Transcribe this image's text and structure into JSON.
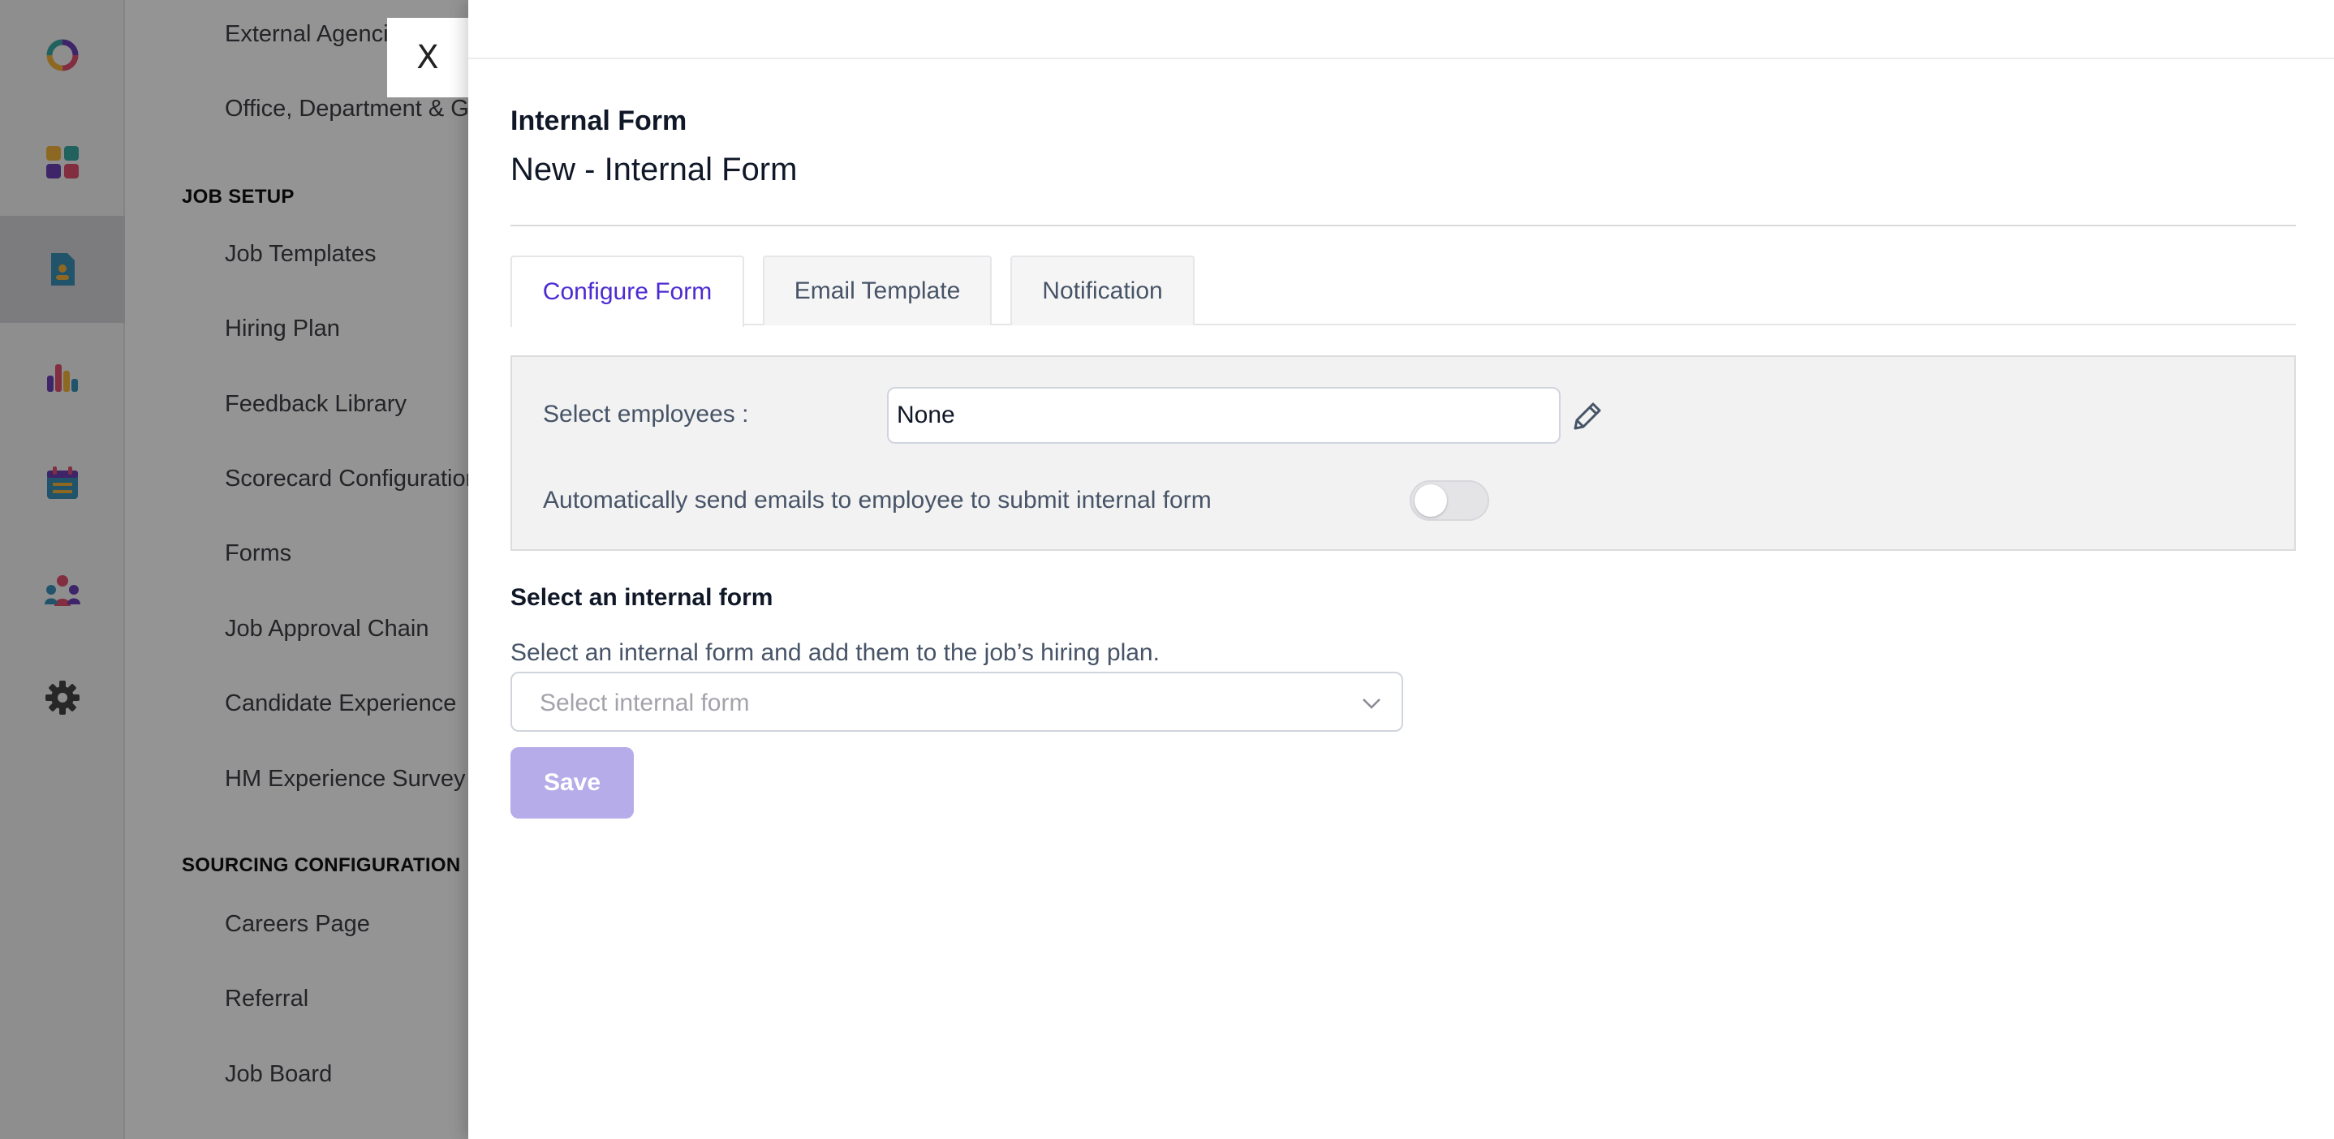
{
  "colors": {
    "accent": "#4c2bd2",
    "save_disabled": "#b5ace9",
    "rail_bg": "#f4f4f6"
  },
  "rail": {
    "items": [
      {
        "icon": "logo-ring-icon"
      },
      {
        "icon": "dashboard-grid-icon"
      },
      {
        "icon": "jobs-document-icon",
        "active": true
      },
      {
        "icon": "reports-bar-chart-icon"
      },
      {
        "icon": "calendar-icon"
      },
      {
        "icon": "people-group-icon"
      },
      {
        "icon": "settings-gear-icon"
      }
    ]
  },
  "settings_nav": {
    "top_items": [
      "External Agencies",
      "Office, Department & Groups"
    ],
    "job_setup_heading": "JOB SETUP",
    "job_setup_items": [
      "Job Templates",
      "Hiring Plan",
      "Feedback Library",
      "Scorecard Configuration",
      "Forms",
      "Job Approval Chain",
      "Candidate Experience",
      "HM Experience Survey"
    ],
    "sourcing_heading": "SOURCING CONFIGURATION",
    "sourcing_items": [
      "Careers Page",
      "Referral",
      "Job Board"
    ]
  },
  "drawer": {
    "close_label": "X",
    "form_kind": "Internal Form",
    "form_title": "New - Internal Form",
    "tabs": [
      {
        "label": "Configure Form",
        "active": true
      },
      {
        "label": "Email Template",
        "active": false
      },
      {
        "label": "Notification",
        "active": false
      }
    ],
    "config": {
      "employees_label": "Select employees :",
      "employees_value": "None",
      "auto_send_label": "Automatically send emails to employee to submit internal form",
      "auto_send_enabled": false
    },
    "section_title": "Select an internal form",
    "section_desc": "Select an internal form and add them to the job’s hiring plan.",
    "select_placeholder": "Select internal form",
    "save_label": "Save"
  }
}
